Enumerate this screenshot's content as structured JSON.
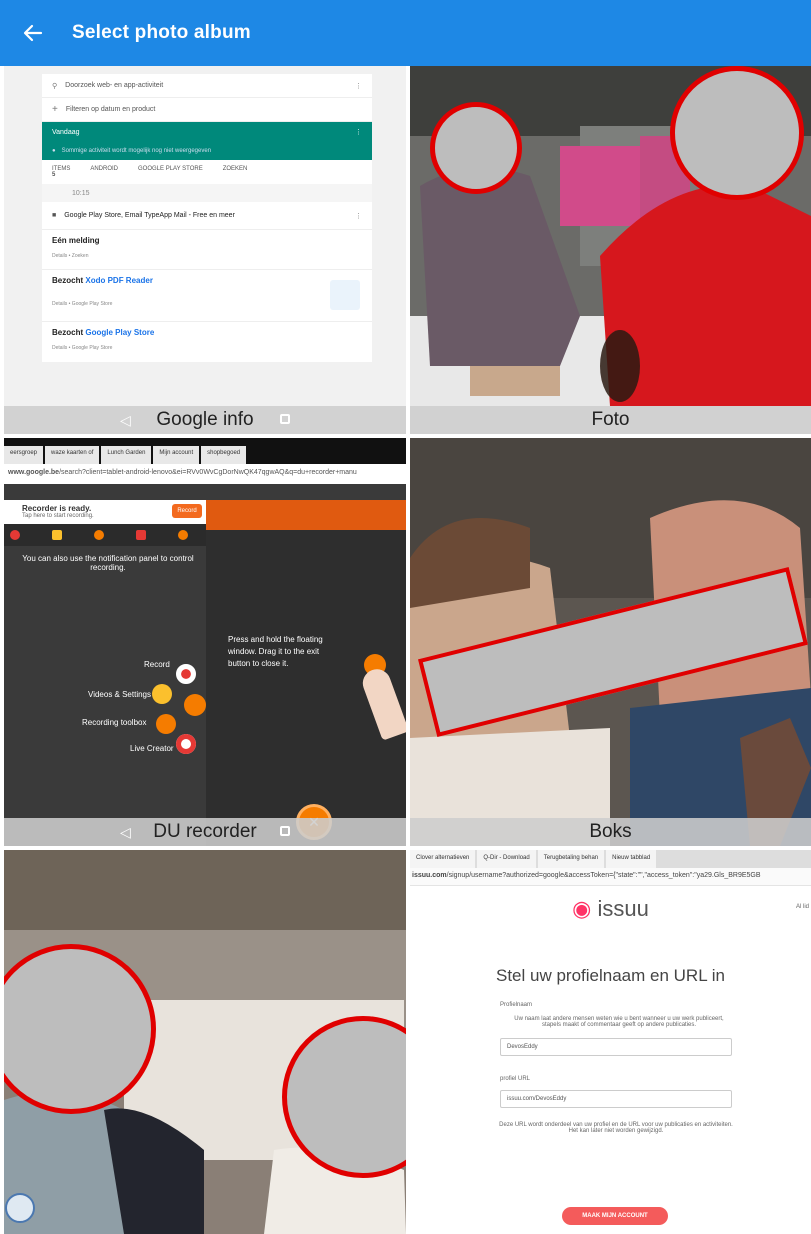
{
  "app": {
    "title": "Select photo album",
    "accent": "#1e88e5",
    "back_icon": "arrow-left-icon"
  },
  "albums": [
    {
      "name": "Google info"
    },
    {
      "name": "Foto"
    },
    {
      "name": "DU recorder"
    },
    {
      "name": "Boks"
    },
    {
      "name": ""
    },
    {
      "name": ""
    }
  ],
  "google_info": {
    "search_placeholder": "Doorzoek web- en app-activiteit",
    "filter": "Filteren op datum en product",
    "today": "Vandaag",
    "notice": "Sommige activiteit wordt mogelijk nog niet weergegeven",
    "stats": [
      "ITEMS",
      "ANDROID",
      "GOOGLE PLAY STORE",
      "ZOEKEN"
    ],
    "items_count": "5",
    "time": "10:15",
    "apps": "Google Play Store, Email TypeApp Mail - Free en meer",
    "notification": "Eén melding",
    "notification_sub": "Details • Zoeken",
    "visited_prefix": "Bezocht",
    "visited_1": "Xodo PDF Reader",
    "visited_1_sub": "Details • Google Play Store",
    "visited_2": "Google Play Store",
    "visited_2_sub": "Details • Google Play Store"
  },
  "du_recorder": {
    "tabs": [
      "eersgroep",
      "waze kaarten of",
      "Lunch Garden",
      "Mijn account",
      "shopbegoed"
    ],
    "url_host": "www.google.be",
    "url_path": "/search?client=tablet-android-lenovo&ei=RVv0WvCgDorNwQK47qgwAQ&q=du+recorder+manu",
    "ready": "Recorder is ready.",
    "tap": "Tap here to start recording.",
    "record_btn": "Record",
    "notif_text": "You can also use the notification panel to control recording.",
    "menu": [
      "Record",
      "Videos & Settings",
      "Recording toolbox",
      "Live Creator"
    ],
    "press_text": "Press and hold the floating window. Drag it to the exit button to close it."
  },
  "issuu": {
    "tabs": [
      "Clover alternatieven",
      "Q-Dir - Download",
      "Terugbetaling behan",
      "Nieuw tabblad"
    ],
    "url_host": "issuu.com",
    "url_path": "/signup/username?authorized=google&accessToken={\"state\":\"\",\"access_token\":\"ya29.Gls_BR9E5GB",
    "logo": "issuu",
    "header_right": "Al lid",
    "heading": "Stel uw profielnaam en URL in",
    "profile_label": "Profielnaam",
    "profile_help": "Uw naam laat andere mensen weten wie u bent wanneer u uw werk publiceert, stapels maakt of commentaar geeft op andere publicaties.",
    "profile_value": "DevosEddy",
    "url_label": "profiel URL",
    "url_value": "issuu.com/DevosEddy",
    "url_help": "Deze URL wordt onderdeel van uw profiel en de URL voor uw publicaties en activiteiten. Het kan later niet worden gewijzigd.",
    "button": "MAAK MIJN ACCOUNT"
  }
}
